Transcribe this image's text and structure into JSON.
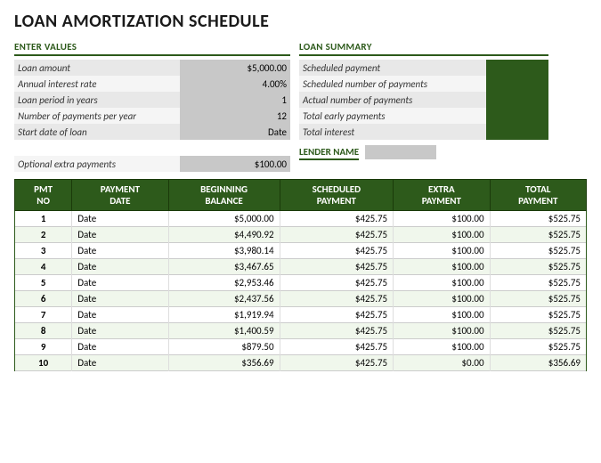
{
  "title": "LOAN AMORTIZATION SCHEDULE",
  "enter_values": {
    "section_title": "ENTER VALUES",
    "fields": [
      {
        "label": "Loan amount",
        "value": "$5,000.00"
      },
      {
        "label": "Annual interest rate",
        "value": "4.00%"
      },
      {
        "label": "Loan period in years",
        "value": "1"
      },
      {
        "label": "Number of payments per year",
        "value": "12"
      },
      {
        "label": "Start date of loan",
        "value": "Date"
      }
    ],
    "extra_label": "Optional extra payments",
    "extra_value": "$100.00"
  },
  "loan_summary": {
    "section_title": "LOAN SUMMARY",
    "fields": [
      {
        "label": "Scheduled payment",
        "value": ""
      },
      {
        "label": "Scheduled number of payments",
        "value": ""
      },
      {
        "label": "Actual number of payments",
        "value": ""
      },
      {
        "label": "Total early payments",
        "value": ""
      },
      {
        "label": "Total interest",
        "value": ""
      }
    ]
  },
  "lender": {
    "label": "LENDER NAME"
  },
  "table": {
    "headers": [
      "PMT\nNO",
      "PAYMENT\nDATE",
      "BEGINNING\nBALANCE",
      "SCHEDULED\nPAYMENT",
      "EXTRA\nPAYMENT",
      "TOTAL\nPAYMENT"
    ],
    "rows": [
      {
        "no": "1",
        "date": "Date",
        "balance": "$5,000.00",
        "scheduled": "$425.75",
        "extra": "$100.00",
        "total": "$525.75"
      },
      {
        "no": "2",
        "date": "Date",
        "balance": "$4,490.92",
        "scheduled": "$425.75",
        "extra": "$100.00",
        "total": "$525.75"
      },
      {
        "no": "3",
        "date": "Date",
        "balance": "$3,980.14",
        "scheduled": "$425.75",
        "extra": "$100.00",
        "total": "$525.75"
      },
      {
        "no": "4",
        "date": "Date",
        "balance": "$3,467.65",
        "scheduled": "$425.75",
        "extra": "$100.00",
        "total": "$525.75"
      },
      {
        "no": "5",
        "date": "Date",
        "balance": "$2,953.46",
        "scheduled": "$425.75",
        "extra": "$100.00",
        "total": "$525.75"
      },
      {
        "no": "6",
        "date": "Date",
        "balance": "$2,437.56",
        "scheduled": "$425.75",
        "extra": "$100.00",
        "total": "$525.75"
      },
      {
        "no": "7",
        "date": "Date",
        "balance": "$1,919.94",
        "scheduled": "$425.75",
        "extra": "$100.00",
        "total": "$525.75"
      },
      {
        "no": "8",
        "date": "Date",
        "balance": "$1,400.59",
        "scheduled": "$425.75",
        "extra": "$100.00",
        "total": "$525.75"
      },
      {
        "no": "9",
        "date": "Date",
        "balance": "$879.50",
        "scheduled": "$425.75",
        "extra": "$100.00",
        "total": "$525.75"
      },
      {
        "no": "10",
        "date": "Date",
        "balance": "$356.69",
        "scheduled": "$425.75",
        "extra": "$0.00",
        "total": "$356.69"
      }
    ]
  }
}
